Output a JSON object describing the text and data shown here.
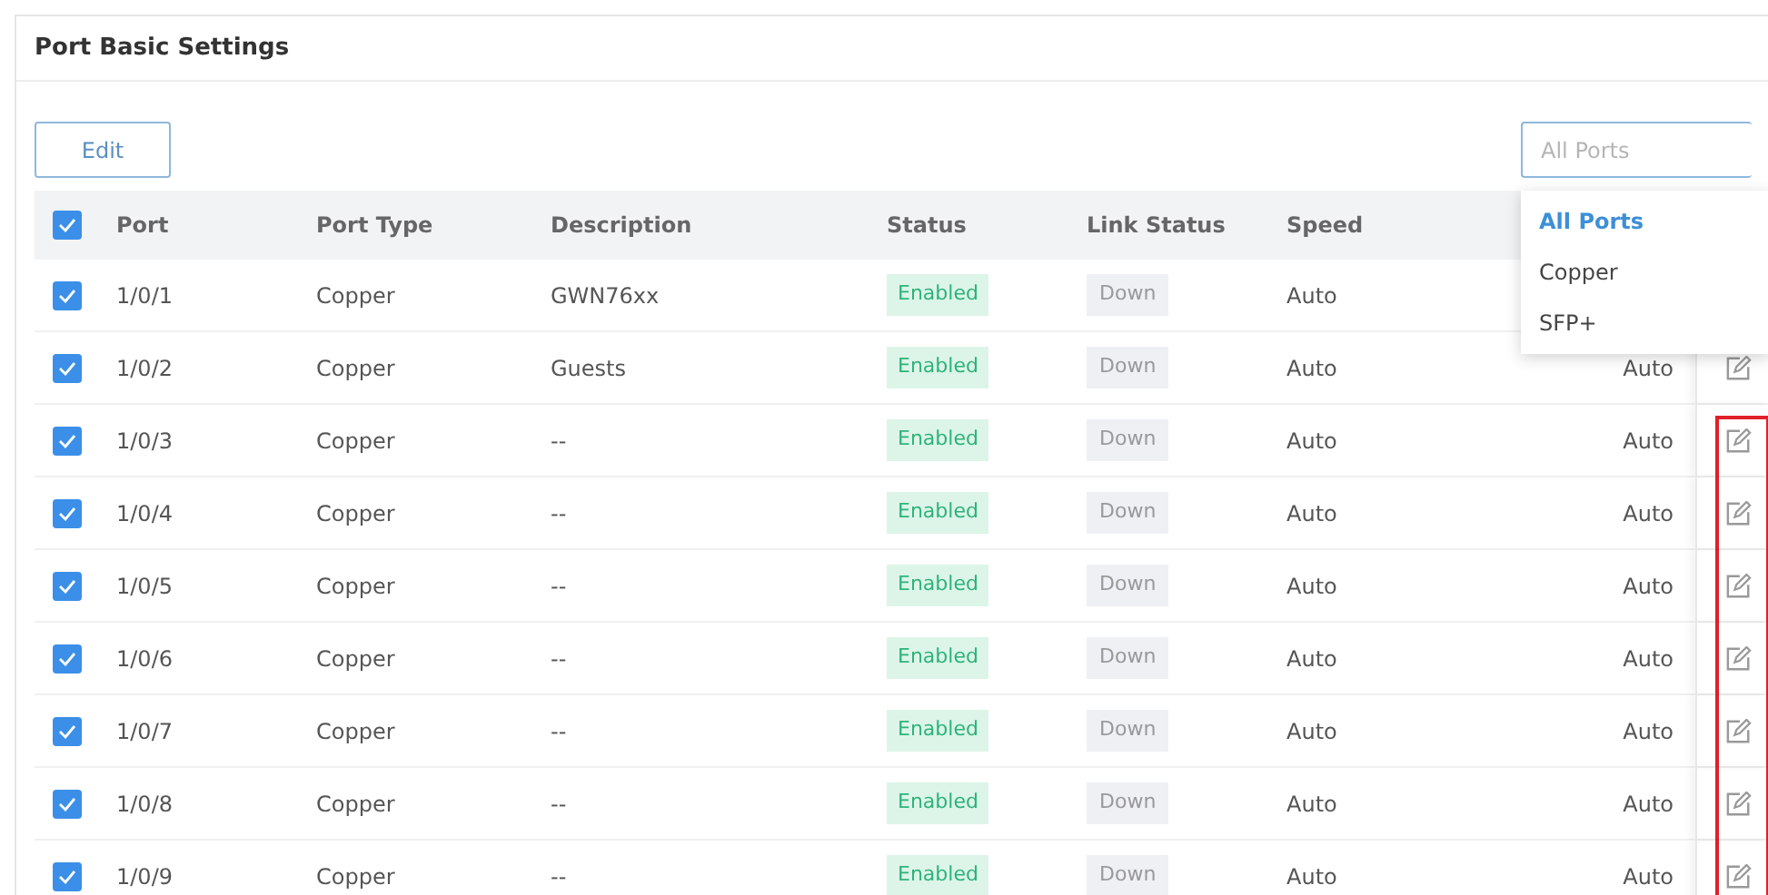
{
  "panel": {
    "title": "Port Basic Settings"
  },
  "toolbar": {
    "edit_button": "Edit",
    "port_filter": {
      "placeholder": "All Ports",
      "expanded": true,
      "options": [
        {
          "label": "All Ports",
          "selected": true
        },
        {
          "label": "Copper",
          "selected": false
        },
        {
          "label": "SFP+",
          "selected": false
        }
      ]
    }
  },
  "table": {
    "all_checked": true,
    "columns": [
      "Port",
      "Port Type",
      "Description",
      "Status",
      "Link Status",
      "Speed"
    ],
    "rows": [
      {
        "checked": true,
        "port": "1/0/1",
        "port_type": "Copper",
        "description": "GWN76xx",
        "status": "Enabled",
        "link_status": "Down",
        "speed": "Auto",
        "highlighted": false
      },
      {
        "checked": true,
        "port": "1/0/2",
        "port_type": "Copper",
        "description": "Guests",
        "status": "Enabled",
        "link_status": "Down",
        "speed": "Auto",
        "column_7": "Auto",
        "edit": true,
        "highlighted": false
      },
      {
        "checked": true,
        "port": "1/0/3",
        "port_type": "Copper",
        "description": "--",
        "status": "Enabled",
        "link_status": "Down",
        "speed": "Auto",
        "column_7": "Auto",
        "edit": true,
        "highlighted": true
      },
      {
        "checked": true,
        "port": "1/0/4",
        "port_type": "Copper",
        "description": "--",
        "status": "Enabled",
        "link_status": "Down",
        "speed": "Auto",
        "column_7": "Auto",
        "edit": true,
        "highlighted": true
      },
      {
        "checked": true,
        "port": "1/0/5",
        "port_type": "Copper",
        "description": "--",
        "status": "Enabled",
        "link_status": "Down",
        "speed": "Auto",
        "column_7": "Auto",
        "edit": true,
        "highlighted": true
      },
      {
        "checked": true,
        "port": "1/0/6",
        "port_type": "Copper",
        "description": "--",
        "status": "Enabled",
        "link_status": "Down",
        "speed": "Auto",
        "column_7": "Auto",
        "edit": true,
        "highlighted": true
      },
      {
        "checked": true,
        "port": "1/0/7",
        "port_type": "Copper",
        "description": "--",
        "status": "Enabled",
        "link_status": "Down",
        "speed": "Auto",
        "column_7": "Auto",
        "edit": true,
        "highlighted": true
      },
      {
        "checked": true,
        "port": "1/0/8",
        "port_type": "Copper",
        "description": "--",
        "status": "Enabled",
        "link_status": "Down",
        "speed": "Auto",
        "column_7": "Auto",
        "edit": true,
        "highlighted": true
      },
      {
        "checked": true,
        "port": "1/0/9",
        "port_type": "Copper",
        "description": "--",
        "status": "Enabled",
        "link_status": "Down",
        "speed": "Auto",
        "column_7": "Auto",
        "edit": true,
        "highlighted": true
      }
    ]
  }
}
